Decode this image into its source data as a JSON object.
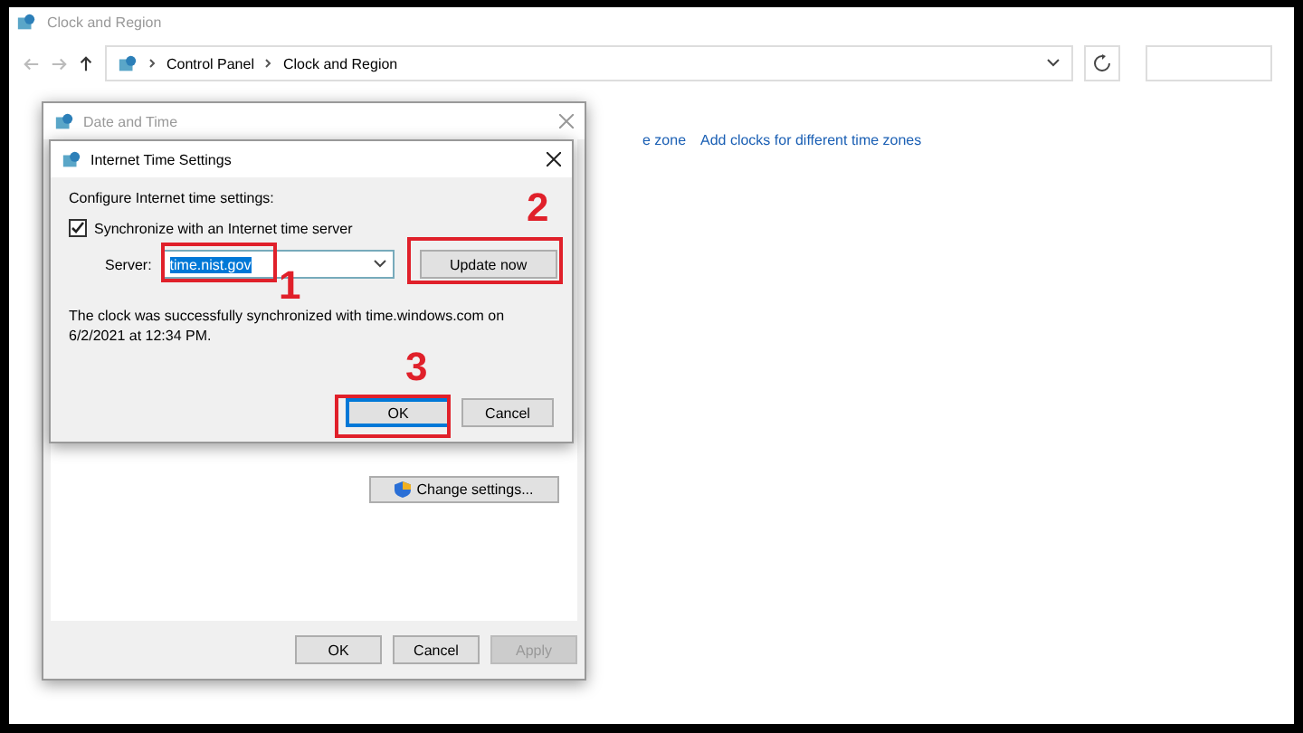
{
  "window": {
    "title": "Clock and Region",
    "path": [
      "Control Panel",
      "Clock and Region"
    ]
  },
  "background_links": [
    "e zone",
    "Add clocks for different time zones"
  ],
  "date_time_dialog": {
    "title": "Date and Time",
    "change_settings": "Change settings...",
    "buttons": [
      {
        "label": "OK",
        "disabled": false
      },
      {
        "label": "Cancel",
        "disabled": false
      },
      {
        "label": "Apply",
        "disabled": true
      }
    ]
  },
  "internet_time_dialog": {
    "title": "Internet Time Settings",
    "heading": "Configure Internet time settings:",
    "sync": {
      "label": "Synchronize with an Internet time server",
      "checked": true
    },
    "server_label": "Server:",
    "server_value": "time.nist.gov",
    "update_button": "Update now",
    "message": "The clock was successfully synchronized with time.windows.com on 6/2/2021 at 12:34 PM.",
    "buttons": [
      {
        "label": "OK",
        "focused": true
      },
      {
        "label": "Cancel",
        "focused": false
      }
    ]
  },
  "annotations": [
    "1",
    "2",
    "3"
  ]
}
